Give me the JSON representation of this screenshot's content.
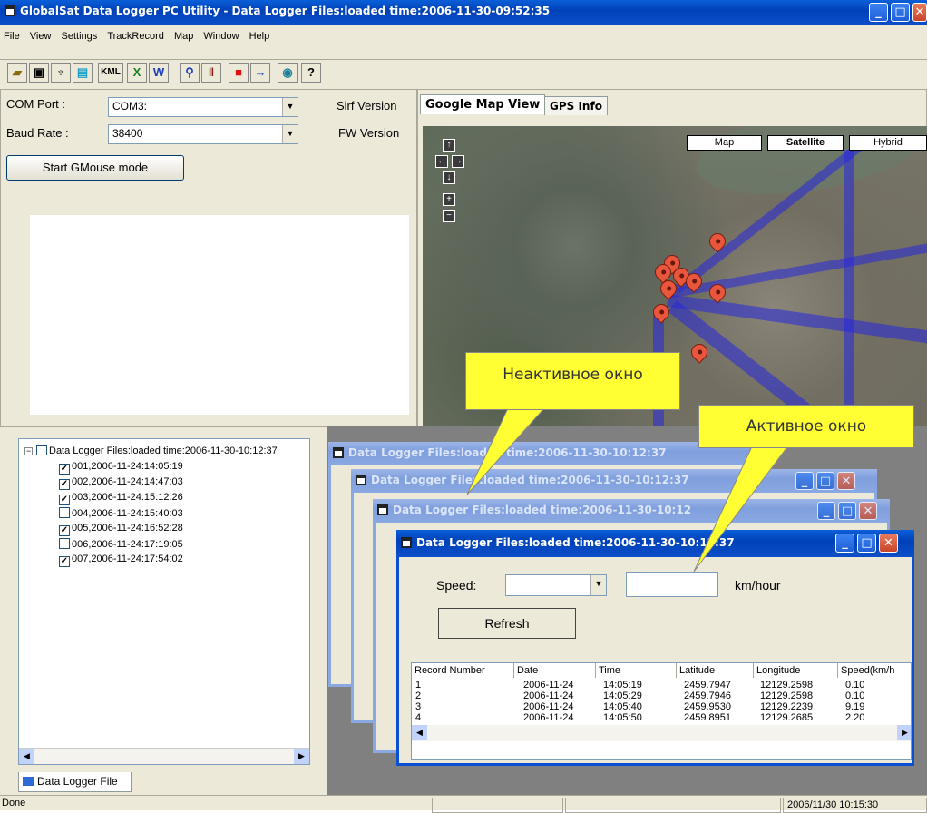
{
  "main_window": {
    "title": "GlobalSat Data Logger PC Utility -  Data Logger Files:loaded time:2006-11-30-09:52:35"
  },
  "menu": [
    "File",
    "View",
    "Settings",
    "TrackRecord",
    "Map",
    "Window",
    "Help"
  ],
  "toolbar": {
    "kml_label": "KML"
  },
  "settings": {
    "com_port_label": "COM Port :",
    "com_port_value": "COM3:",
    "baud_rate_label": "Baud Rate :",
    "baud_rate_value": "38400",
    "sirf_label": "Sirf Version",
    "fw_label": "FW Version",
    "gmouse_button": "Start GMouse mode"
  },
  "map_tabs": [
    "Google Map View",
    "GPS Info"
  ],
  "map_types": [
    "Map",
    "Satellite",
    "Hybrid"
  ],
  "tree": {
    "root": "Data Logger Files:loaded time:2006-11-30-10:12:37",
    "items": [
      {
        "label": "001,2006-11-24:14:05:19",
        "checked": true
      },
      {
        "label": "002,2006-11-24:14:47:03",
        "checked": true
      },
      {
        "label": "003,2006-11-24:15:12:26",
        "checked": true
      },
      {
        "label": "004,2006-11-24:15:40:03",
        "checked": false
      },
      {
        "label": "005,2006-11-24:16:52:28",
        "checked": true
      },
      {
        "label": "006,2006-11-24:17:19:05",
        "checked": false
      },
      {
        "label": "007,2006-11-24:17:54:02",
        "checked": true
      }
    ],
    "tab_label": "Data Logger File"
  },
  "child_windows": {
    "title_1": "Data Logger Files:loaded time:2006-11-30-10:12:37",
    "title_2": "Data Logger Files:loaded time:2006-11-30-10:12:37",
    "title_3": "Data Logger Files:loaded time:2006-11-30-10:12",
    "title_active": "Data Logger Files:loaded time:2006-11-30-10:12:37"
  },
  "active_window": {
    "speed_label": "Speed:",
    "unit": "km/hour",
    "refresh_button": "Refresh",
    "columns": [
      "Record Number",
      "Date",
      "Time",
      "Latitude",
      "Longitude",
      "Speed(km/h"
    ],
    "rows": [
      [
        "1",
        "2006-11-24",
        "14:05:19",
        "2459.7947",
        "12129.2598",
        "0.10"
      ],
      [
        "2",
        "2006-11-24",
        "14:05:29",
        "2459.7946",
        "12129.2598",
        "0.10"
      ],
      [
        "3",
        "2006-11-24",
        "14:05:40",
        "2459.9530",
        "12129.2239",
        "9.19"
      ],
      [
        "4",
        "2006-11-24",
        "14:05:50",
        "2459.8951",
        "12129.2685",
        "2.20"
      ]
    ]
  },
  "callouts": {
    "inactive": "Неактивное окно",
    "active": "Активное окно"
  },
  "status": {
    "text": "Done",
    "datetime": "2006/11/30 10:15:30"
  }
}
